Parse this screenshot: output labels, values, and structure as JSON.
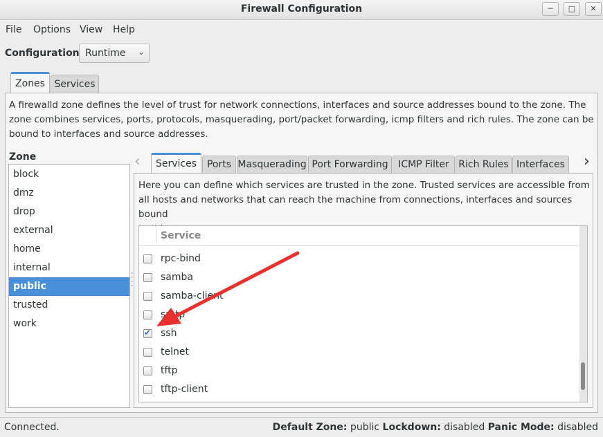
{
  "window": {
    "title": "Firewall Configuration"
  },
  "menu": [
    "File",
    "Options",
    "View",
    "Help"
  ],
  "configuration": {
    "label": "Configuration:",
    "value": "Runtime"
  },
  "top_tabs": [
    {
      "label": "Zones",
      "active": true
    },
    {
      "label": "Services",
      "active": false
    }
  ],
  "zone_description": "A firewalld zone defines the level of trust for network connections, interfaces and source addresses bound to the zone. The zone combines services, ports, protocols, masquerading, port/packet forwarding, icmp filters and rich rules. The zone can be bound to interfaces and source addresses.",
  "zone_description_lines": [
    "A firewalld zone defines the level of trust for network connections, interfaces and source addresses bound to the zone. The",
    "zone combines services, ports, protocols, masquerading, port/packet forwarding, icmp filters and rich rules. The zone can be",
    "bound to interfaces and source addresses."
  ],
  "zones": {
    "label": "Zone",
    "items": [
      "block",
      "dmz",
      "drop",
      "external",
      "home",
      "internal",
      "public",
      "trusted",
      "work"
    ],
    "selected": "public"
  },
  "zone_tabs": [
    "Services",
    "Ports",
    "Masquerading",
    "Port Forwarding",
    "ICMP Filter",
    "Rich Rules",
    "Interfaces"
  ],
  "active_zone_tab": "Services",
  "services_description_lines": [
    "Here you can define which services are trusted in the zone. Trusted services are accessible from",
    "all hosts and networks that can reach the machine from connections, interfaces and sources bound",
    "to this zone."
  ],
  "services_table": {
    "column": "Service",
    "rows": [
      {
        "name": "rpc-bind",
        "checked": false
      },
      {
        "name": "samba",
        "checked": false
      },
      {
        "name": "samba-client",
        "checked": false
      },
      {
        "name": "smtp",
        "checked": false
      },
      {
        "name": "ssh",
        "checked": true
      },
      {
        "name": "telnet",
        "checked": false
      },
      {
        "name": "tftp",
        "checked": false
      },
      {
        "name": "tftp-client",
        "checked": false
      }
    ]
  },
  "status": {
    "connection": "Connected.",
    "default_zone_label": "Default Zone:",
    "default_zone": "public",
    "lockdown_label": "Lockdown:",
    "lockdown": "disabled",
    "panic_label": "Panic Mode:",
    "panic": "disabled"
  },
  "colors": {
    "accent": "#4a90d9",
    "annotation_arrow": "#e8312f"
  }
}
